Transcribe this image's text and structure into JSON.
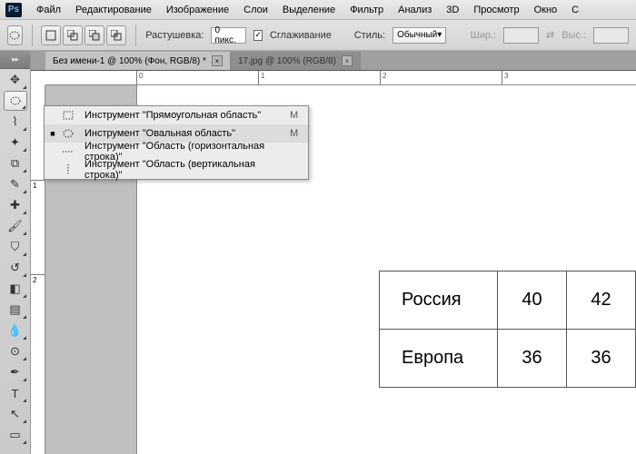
{
  "menubar": [
    "Файл",
    "Редактирование",
    "Изображение",
    "Слои",
    "Выделение",
    "Фильтр",
    "Анализ",
    "3D",
    "Просмотр",
    "Окно",
    "С"
  ],
  "logo": "Ps",
  "options": {
    "feather_label": "Растушевка:",
    "feather_value": "0 пикс.",
    "antialias_label": "Сглаживание",
    "antialias_checked": "✓",
    "style_label": "Стиль:",
    "style_value": "Обычный",
    "width_label": "Шир.:",
    "height_label": "Выс.:"
  },
  "tabs": [
    {
      "label": "Без имени-1 @ 100% (Фон, RGB/8) *",
      "active": true
    },
    {
      "label": "17.jpg @ 100% (RGB/8)",
      "active": false
    }
  ],
  "ruler_h": [
    "0",
    "1",
    "2",
    "3"
  ],
  "ruler_v": [
    "1",
    "2"
  ],
  "flyout": {
    "items": [
      {
        "label": "Инструмент \"Прямоугольная область\"",
        "key": "M",
        "selected": false,
        "bullet": ""
      },
      {
        "label": "Инструмент \"Овальная область\"",
        "key": "M",
        "selected": true,
        "bullet": "■"
      },
      {
        "label": "Инструмент \"Область (горизонтальная строка)\"",
        "key": "",
        "selected": false,
        "bullet": ""
      },
      {
        "label": "Инструмент \"Область (вертикальная строка)\"",
        "key": "",
        "selected": false,
        "bullet": ""
      }
    ]
  },
  "table": {
    "rows": [
      [
        "Россия",
        "40",
        "42"
      ],
      [
        "Европа",
        "36",
        "36"
      ]
    ]
  }
}
